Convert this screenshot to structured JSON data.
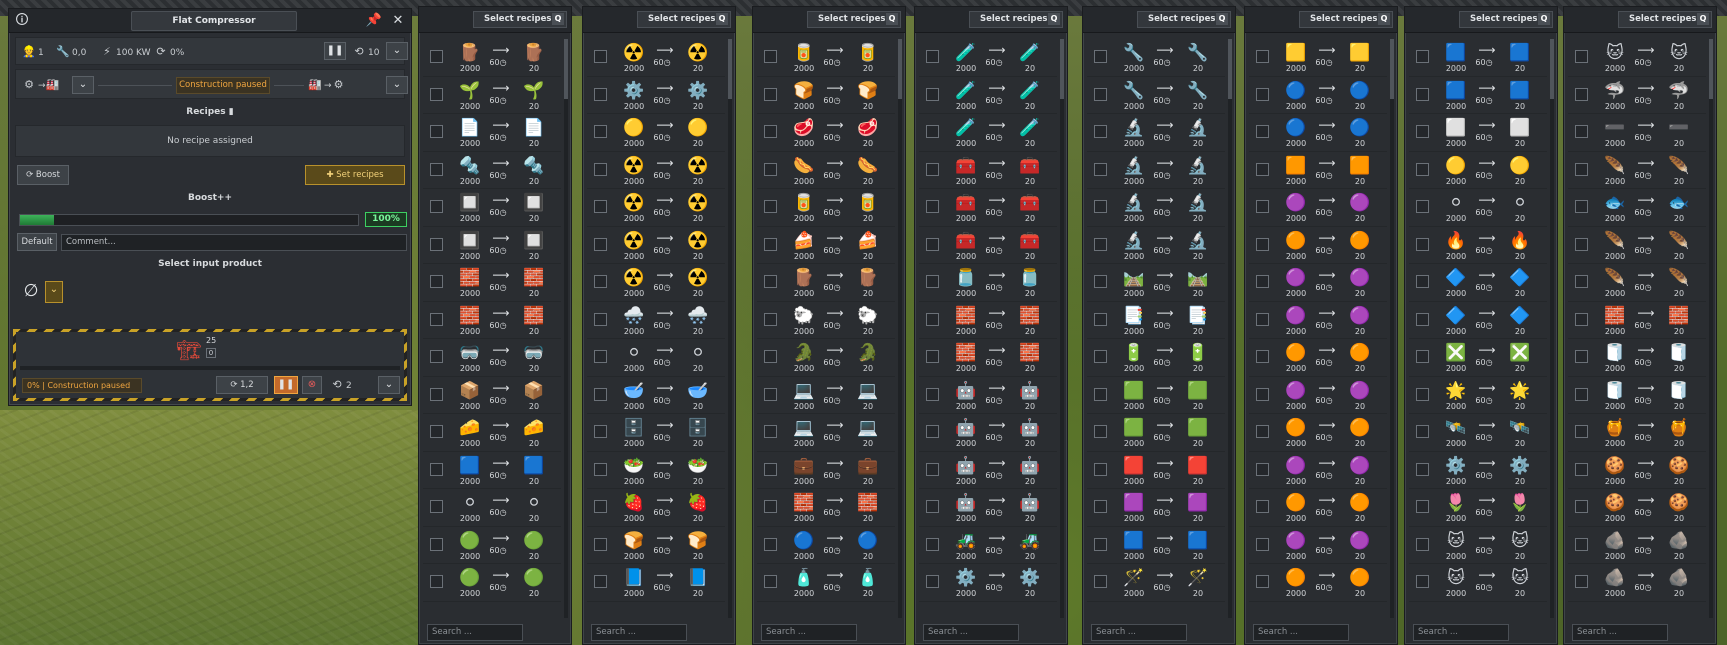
{
  "main_panel": {
    "title": "Flat Compressor",
    "stats": {
      "workers": "1",
      "maintenance": "0,0",
      "power": "100 KW",
      "efficiency": "0%"
    },
    "priority": "10",
    "flow_left": "→",
    "flow_right": "→",
    "status_badge": "Construction paused",
    "recipes_section_title": "Recipes",
    "no_recipe_text": "No recipe assigned",
    "boost_button": "Boost",
    "set_recipes_button": "Set recipes",
    "boost_section_title": "Boost++",
    "boost_percent": "100%",
    "boost_fraction": 0.1,
    "default_button": "Default",
    "comment_placeholder": "Comment...",
    "input_section_title": "Select input product",
    "empty_product_symbol": "∅",
    "construction_count": "25",
    "construction_count_sub": "0",
    "construction_status": "0% | Construction paused",
    "footer_number": "1,2",
    "footer_priority": "2"
  },
  "recipe_columns": {
    "header_label": "Select recipes",
    "search_placeholder": "Search ...",
    "input_qty": "2000",
    "time": "60",
    "output_qty": "20",
    "columns": [
      {
        "items": [
          "🪵",
          "🌱",
          "📄",
          "🔩",
          "🔲",
          "🔲",
          "🧱",
          "🧱",
          "🥽",
          "📦",
          "🧀",
          "🟦",
          "⚪",
          "🟢",
          "🟢"
        ]
      },
      {
        "items": [
          "☢️",
          "⚙️",
          "🟡",
          "☢️",
          "☢️",
          "☢️",
          "☢️",
          "🌨️",
          "⚪",
          "🥣",
          "🗄️",
          "🥗",
          "🍓",
          "🍞",
          "📘"
        ]
      },
      {
        "items": [
          "🥫",
          "🍞",
          "🥩",
          "🌭",
          "🥫",
          "🍰",
          "🪵",
          "🐑",
          "🐊",
          "💻",
          "💻",
          "💼",
          "🧱",
          "🔵",
          "🧴"
        ]
      },
      {
        "items": [
          "🧪",
          "🧪",
          "🧪",
          "🧰",
          "🧰",
          "🧰",
          "🫙",
          "🧱",
          "🧱",
          "🤖",
          "🤖",
          "🤖",
          "🤖",
          "🚜",
          "⚙️"
        ]
      },
      {
        "items": [
          "🔧",
          "🔧",
          "🔬",
          "🔬",
          "🔬",
          "🔬",
          "🛤️",
          "📑",
          "🔋",
          "🟩",
          "🟩",
          "🟥",
          "🟪",
          "🟦",
          "🪄"
        ]
      },
      {
        "items": [
          "🟨",
          "🔵",
          "🔵",
          "🟧",
          "🟣",
          "🟠",
          "🟣",
          "🟣",
          "🟠",
          "🟣",
          "🟠",
          "🟣",
          "🟠",
          "🟣",
          "🟠"
        ]
      },
      {
        "items": [
          "🟦",
          "🟦",
          "⬜",
          "🟡",
          "⚪",
          "🔥",
          "🔷",
          "🔷",
          "❎",
          "🌟",
          "🛰️",
          "⚙️",
          "🌷",
          "🐱",
          "🐱"
        ]
      },
      {
        "items": [
          "🐱",
          "🦈",
          "➖",
          "🪶",
          "🐟",
          "🪶",
          "🪶",
          "🧱",
          "🧻",
          "🧻",
          "🍯",
          "🍪",
          "🍪",
          "🪨",
          "🪨"
        ]
      }
    ]
  }
}
